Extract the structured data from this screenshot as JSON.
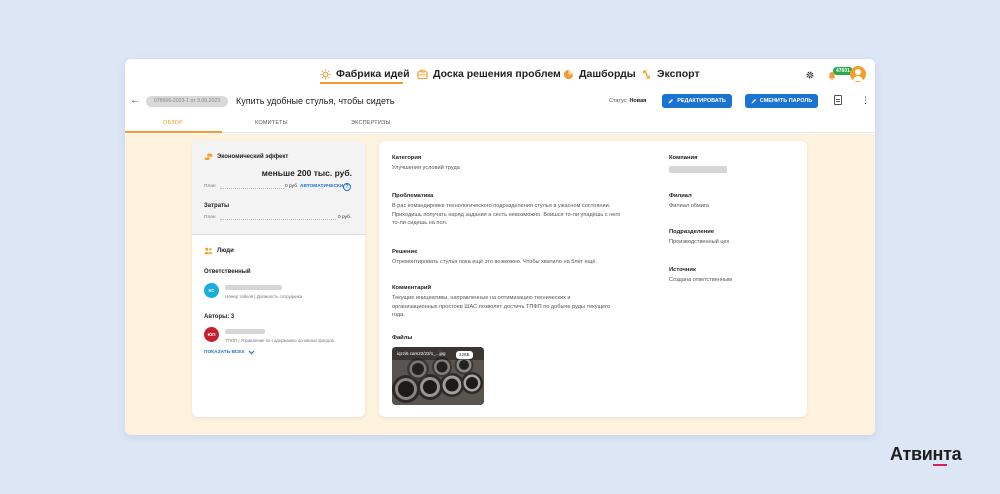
{
  "nav": {
    "items": [
      {
        "label": "Фабрика идей",
        "icon": "lightbulb-icon"
      },
      {
        "label": "Доска решения проблем",
        "icon": "briefcase-icon"
      },
      {
        "label": "Дашборды",
        "icon": "pie-chart-icon"
      },
      {
        "label": "Экспорт",
        "icon": "export-icon"
      }
    ],
    "active": "Фабрика идей",
    "notification_badge": "47601"
  },
  "header": {
    "idea_id": "078666-2023-1 от 3.05.2023",
    "title": "Купить удобные стулья, чтобы сидеть",
    "status_label": "Статус:",
    "status_value": "Новая",
    "edit_button": "РЕДАКТИРОВАТЬ",
    "change_password_button": "СМЕНИТЬ ПАРОЛЬ"
  },
  "tabs": [
    {
      "label": "ОБЗОР",
      "active": true
    },
    {
      "label": "КОМИТЕТЫ",
      "active": false
    },
    {
      "label": "ЭКСПЕРТИЗЫ",
      "active": false
    }
  ],
  "economic": {
    "title": "Экономический эффект",
    "value": "меньше 200 тыс. руб.",
    "plan_label": "План",
    "plan_value": "0 руб.",
    "auto_label": "АВТОМАТИЧЕСКИ",
    "costs_title": "Затраты",
    "costs_plan_label": "План",
    "costs_plan_value": "0 руб."
  },
  "people": {
    "title": "Люди",
    "responsible_label": "Ответственный",
    "responsible_initials": "КС",
    "responsible_sub": "Номер табеля | Должность сотрудника",
    "authors_label": "Авторы: 3",
    "author_initials": "ЮП",
    "author_sub": "ТПОП | Управление по содержанию основных фондов",
    "show_all": "ПОКАЗАТЬ ВСЕХ"
  },
  "details": {
    "category_label": "Категория",
    "category_value": "Улучшения условий труда",
    "problem_label": "Проблематика",
    "problem_value": "В рас командировке технологического подразделения стулья в ужасном состоянии. Приходишь получать наряд задания а сесть невозможно. Боишся то-ли упадёшь с него то-ли сидешь на пол.",
    "solution_label": "Решение",
    "solution_value": "Отремонтировать стулья пока ещё это возможно. Чтобы хватило на 5лет ещё.",
    "comment_label": "Комментарий",
    "comment_value": "Текущие инициативы, направленные на оптимизацию технических и организационных простоев ШАС позволят достичь ТПФП по добыче руды текущего года.",
    "files_label": "Файлы",
    "file_name": "iqzzi6 cam22/23/1_...jpg",
    "file_size": "22КБ",
    "company_label": "Компания",
    "branch_label": "Филиал",
    "branch_value": "Филиал обмига",
    "division_label": "Подразделение",
    "division_value": "Производственный цех",
    "source_label": "Источник",
    "source_value": "Создана ответственным"
  },
  "brand": {
    "logo_text": "Атвинта",
    "accent_color": "#f39c2c",
    "primary_color": "#1a73d1",
    "logo_accent": "#d71f5c"
  }
}
